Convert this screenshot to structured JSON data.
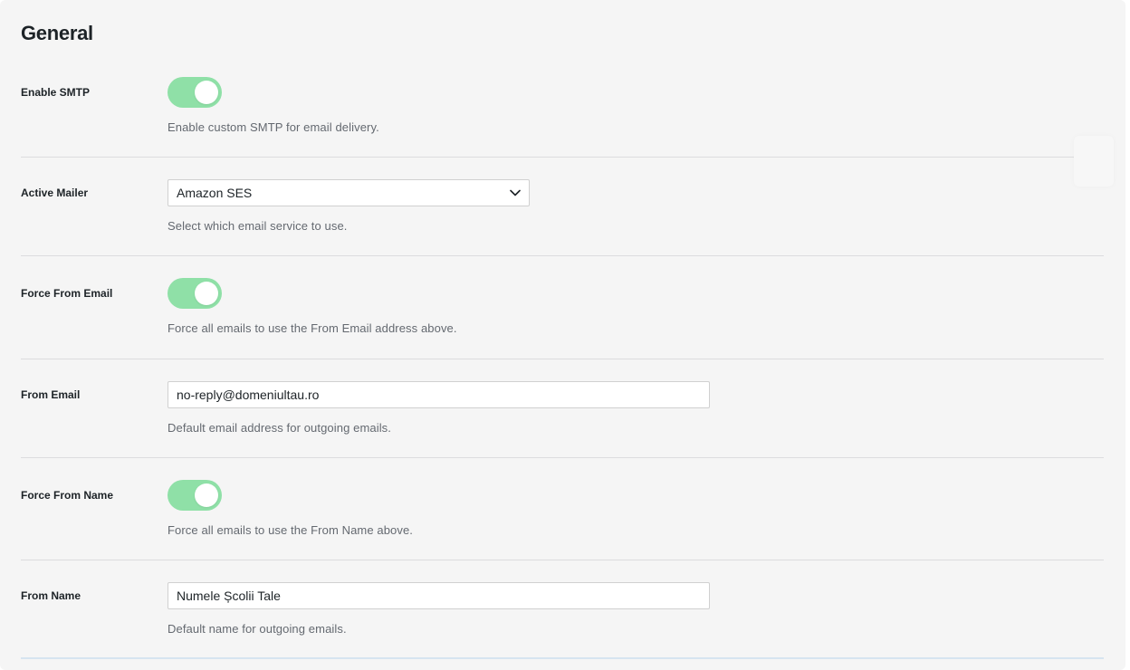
{
  "section": {
    "title": "General"
  },
  "settings": {
    "enable_smtp": {
      "label": "Enable SMTP",
      "enabled": true,
      "description": "Enable custom SMTP for email delivery."
    },
    "active_mailer": {
      "label": "Active Mailer",
      "selected": "Amazon SES",
      "description": "Select which email service to use."
    },
    "force_from_email": {
      "label": "Force From Email",
      "enabled": true,
      "description": "Force all emails to use the From Email address above."
    },
    "from_email": {
      "label": "From Email",
      "value": "no-reply@domeniultau.ro",
      "description": "Default email address for outgoing emails."
    },
    "force_from_name": {
      "label": "Force From Name",
      "enabled": true,
      "description": "Force all emails to use the From Name above."
    },
    "from_name": {
      "label": "From Name",
      "value": "Numele Școlii Tale",
      "description": "Default name for outgoing emails."
    }
  },
  "colors": {
    "toggle_on": "#8fe0a7",
    "panel_bg": "#f5f5f5",
    "description_text": "#646970"
  },
  "icons": {
    "select_arrow": "chevron-down-icon"
  }
}
